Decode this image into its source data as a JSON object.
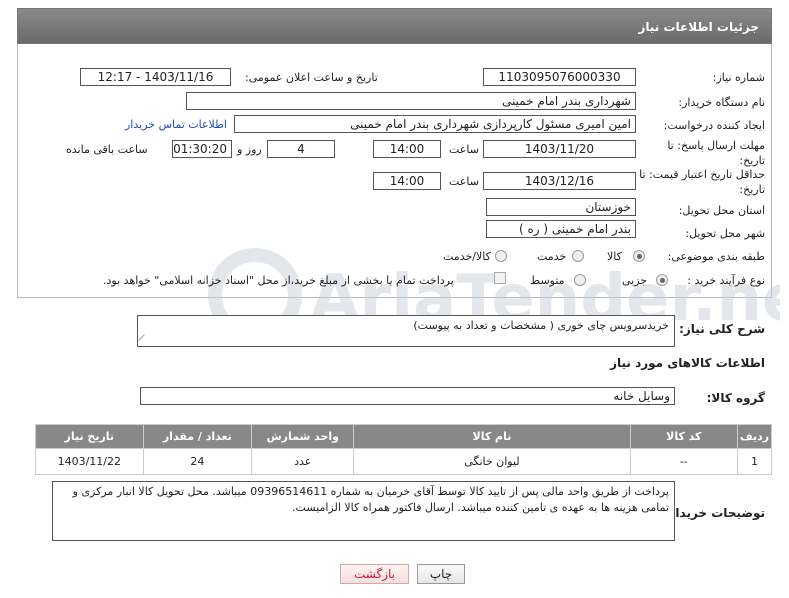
{
  "header": {
    "title": "جزئیات اطلاعات نیاز"
  },
  "form": {
    "need_number_label": "شماره نیاز:",
    "need_number": "1103095076000330",
    "announce_label": "تاریخ و ساعت اعلان عمومی:",
    "announce_value": "1403/11/16 - 12:17",
    "buyer_org_label": "نام دستگاه خریدار:",
    "buyer_org": "شهرداری بندر امام خمینی",
    "requester_label": "ایجاد کننده درخواست:",
    "requester": "امین امیری مسئول کارپردازی شهرداری بندر امام خمینی",
    "contact_link": "اطلاعات تماس خریدار",
    "deadline_label": "مهلت ارسال پاسخ: تا تاریخ:",
    "deadline_date": "1403/11/20",
    "time_label": "ساعت",
    "deadline_time": "14:00",
    "days": "4",
    "days_label": "روز و",
    "remaining": "01:30:20",
    "remaining_label": "ساعت باقی مانده",
    "validity_label": "حداقل تاریخ اعتبار قیمت: تا تاریخ:",
    "validity_date": "1403/12/16",
    "validity_time": "14:00",
    "province_label": "استان محل تحویل:",
    "province": "خوزستان",
    "city_label": "شهر محل تحویل:",
    "city": "بندر امام خمینی ( ره )",
    "category_label": "طبقه بندی موضوعی:",
    "category_options": [
      "کالا",
      "خدمت",
      "کالا/خدمت"
    ],
    "process_label": "نوع فرآیند خرید :",
    "process_options": [
      "جزیی",
      "متوسط"
    ],
    "payment_note": "پرداخت تمام یا بخشی از مبلغ خرید،از محل \"اسناد خزانه اسلامی\" خواهد بود."
  },
  "description": {
    "label": "شرح کلی نیاز:",
    "value": "خریدسرویس چای خوری ( مشخصات و تعداد به پیوست)"
  },
  "goods": {
    "section_title": "اطلاعات کالاهای مورد نیاز",
    "group_label": "گروه کالا:",
    "group_value": "وسایل خانه",
    "columns": [
      "ردیف",
      "کد کالا",
      "نام کالا",
      "واحد شمارش",
      "تعداد / مقدار",
      "تاریخ نیاز"
    ],
    "rows": [
      [
        "1",
        "--",
        "لیوان خانگی",
        "عدد",
        "24",
        "1403/11/22"
      ]
    ]
  },
  "buyer_notes": {
    "label": "توضیحات خریدار:",
    "value": "پرداخت از طریق واحد مالی پس از تایید کالا توسط آقای خرمیان به شماره 09396514611 میباشد. محل تحویل کالا انبار مرکزی و تمامی هزینه ها به عهده ی تامین کننده میباشد. ارسال فاکتور همراه کالا الزامیست."
  },
  "buttons": {
    "print": "چاپ",
    "back": "بازگشت"
  },
  "watermark": "AriaTender.net"
}
